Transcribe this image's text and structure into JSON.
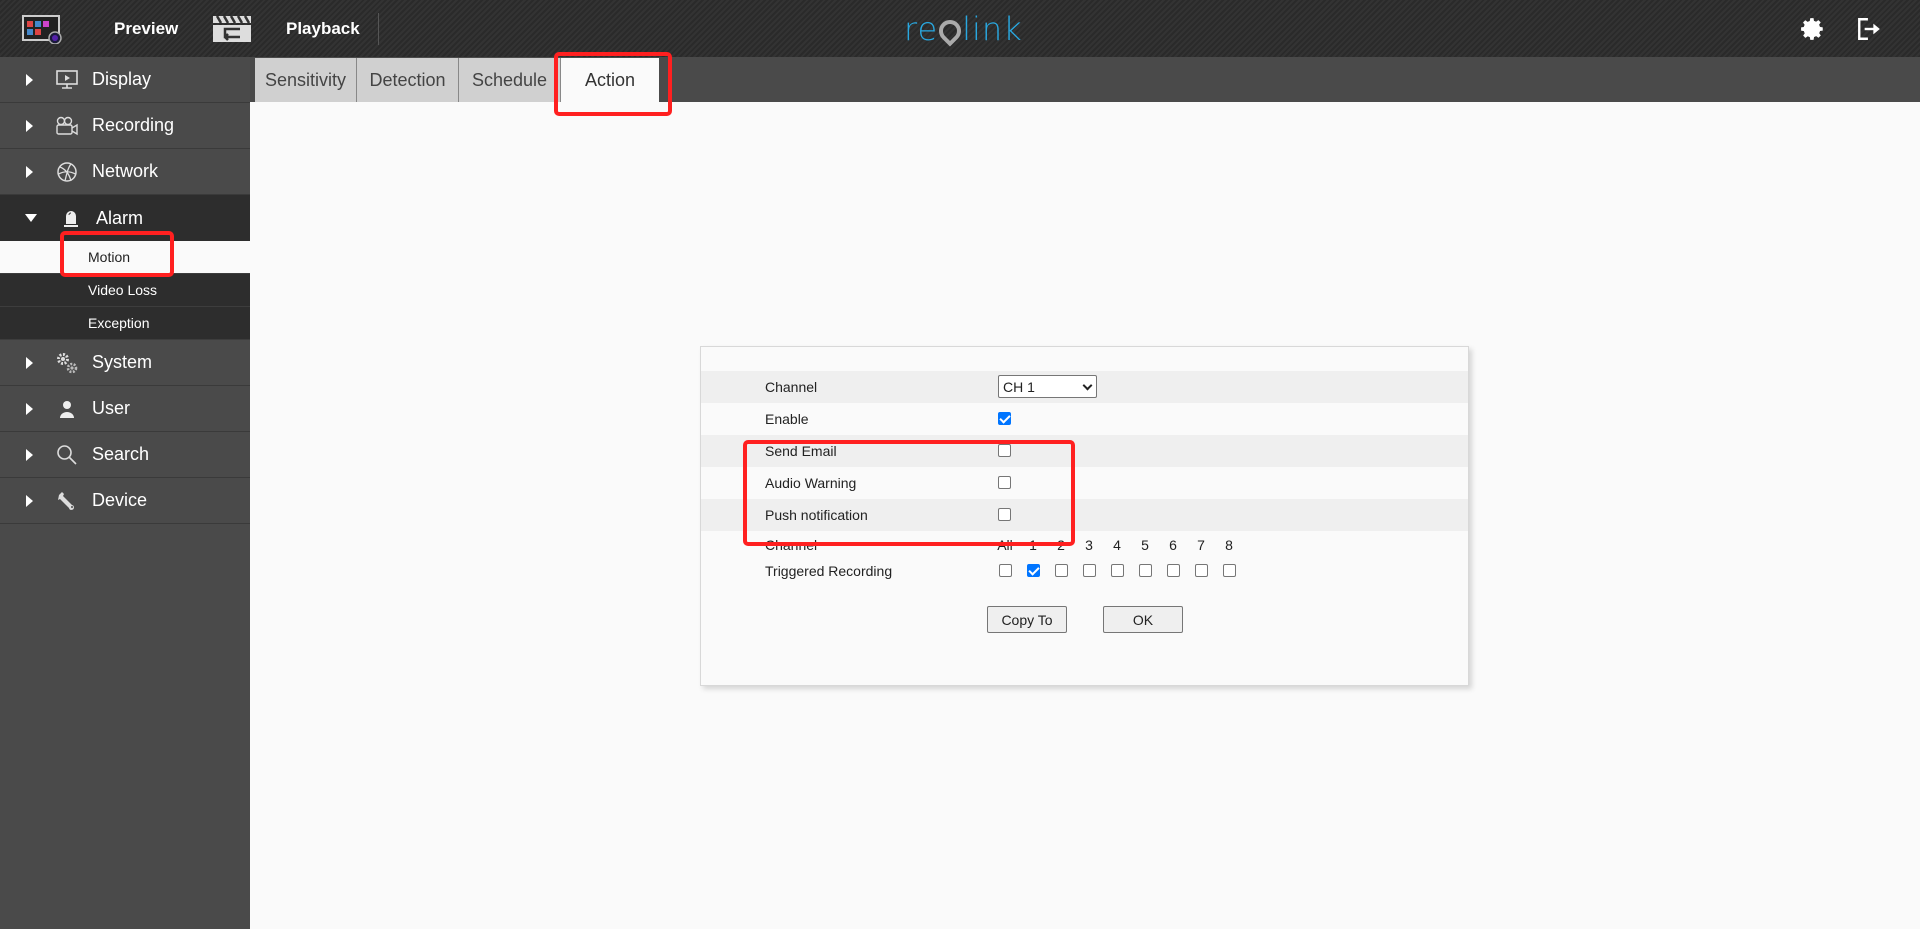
{
  "header": {
    "preview_label": "Preview",
    "playback_label": "Playback",
    "logo_text": {
      "pre": "re",
      "post": "link"
    },
    "brand_color": "#29a8e0"
  },
  "sidebar": {
    "items": [
      {
        "label": "Display",
        "icon": "monitor-icon"
      },
      {
        "label": "Recording",
        "icon": "video-camera-icon"
      },
      {
        "label": "Network",
        "icon": "globe-icon"
      },
      {
        "label": "Alarm",
        "icon": "alarm-siren-icon",
        "expanded": true,
        "children": [
          {
            "label": "Motion",
            "active": true
          },
          {
            "label": "Video Loss"
          },
          {
            "label": "Exception"
          }
        ]
      },
      {
        "label": "System",
        "icon": "gears-icon"
      },
      {
        "label": "User",
        "icon": "user-icon"
      },
      {
        "label": "Search",
        "icon": "search-icon"
      },
      {
        "label": "Device",
        "icon": "wrench-icon"
      }
    ]
  },
  "tabs": [
    {
      "label": "Sensitivity"
    },
    {
      "label": "Detection"
    },
    {
      "label": "Schedule"
    },
    {
      "label": "Action",
      "active": true
    }
  ],
  "form": {
    "channel_label": "Channel",
    "channel_value": "CH 1",
    "enable_label": "Enable",
    "enable_checked": true,
    "send_email_label": "Send Email",
    "send_email_checked": false,
    "audio_warning_label": "Audio Warning",
    "audio_warning_checked": false,
    "push_label": "Push notification",
    "push_checked": false,
    "grid_channel_label": "Channel",
    "grid_headers": [
      "All",
      "1",
      "2",
      "3",
      "4",
      "5",
      "6",
      "7",
      "8"
    ],
    "triggered_label": "Triggered Recording",
    "triggered_checked": [
      false,
      true,
      false,
      false,
      false,
      false,
      false,
      false,
      false
    ],
    "copy_to_label": "Copy To",
    "ok_label": "OK"
  },
  "highlight_color": "#ff2020"
}
